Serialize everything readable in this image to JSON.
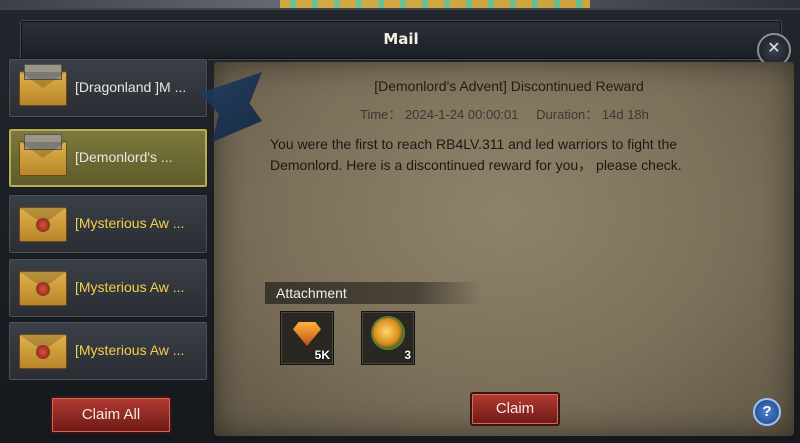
{
  "window": {
    "title": "Mail"
  },
  "sidebar": {
    "items": [
      {
        "label": "[Dragonland ]M ...",
        "read": true,
        "selected": false
      },
      {
        "label": "[Demonlord's  ...",
        "read": true,
        "selected": true
      },
      {
        "label": "[Mysterious Aw ...",
        "read": false,
        "selected": false
      },
      {
        "label": "[Mysterious Aw ...",
        "read": false,
        "selected": false
      },
      {
        "label": "[Mysterious Aw ...",
        "read": false,
        "selected": false
      }
    ],
    "claim_all_label": "Claim All"
  },
  "mail": {
    "subject": "[Demonlord's Advent] Discontinued Reward",
    "time": "Time： 2024-1-24 00:00:01",
    "duration": "Duration： 14d 18h",
    "body": "You were the first to reach RB4LV.311 and led warriors to fight the Demonlord. Here is a discontinued reward for you， please check.",
    "attachment_header": "Attachment",
    "attachments": [
      {
        "icon": "gem-icon",
        "qty": "5K"
      },
      {
        "icon": "orb-icon",
        "qty": "3"
      }
    ],
    "claim_label": "Claim"
  },
  "help_label": "?",
  "close_label": "✕"
}
